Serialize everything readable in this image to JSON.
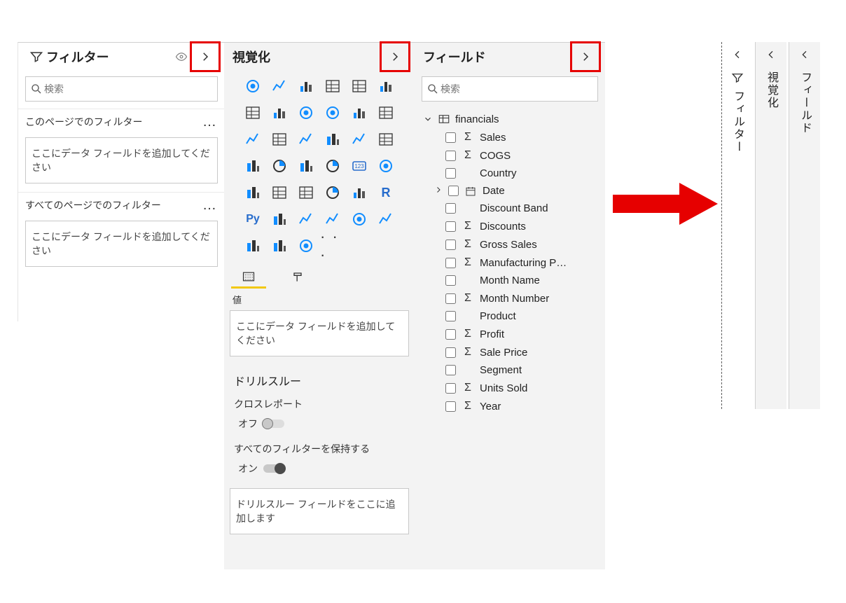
{
  "filters": {
    "title": "フィルター",
    "search_placeholder": "検索",
    "section_page": "このページでのフィルター",
    "section_all": "すべてのページでのフィルター",
    "dropzone_text": "ここにデータ フィールドを追加してください"
  },
  "viz": {
    "title": "視覚化",
    "values_label": "値",
    "values_drop": "ここにデータ フィールドを追加してください",
    "drill_heading": "ドリルスルー",
    "cross_report": "クロスレポート",
    "cross_report_state": "オフ",
    "keep_all": "すべてのフィルターを保持する",
    "keep_all_state": "オン",
    "drill_drop": "ドリルスルー フィールドをここに追加します"
  },
  "fields": {
    "title": "フィールド",
    "search_placeholder": "検索",
    "table": {
      "name": "financials",
      "columns": [
        {
          "name": "Sales",
          "sigma": true
        },
        {
          "name": "COGS",
          "sigma": true
        },
        {
          "name": "Country",
          "sigma": false
        },
        {
          "name": "Date",
          "sigma": false,
          "date": true,
          "expandable": true
        },
        {
          "name": "Discount Band",
          "sigma": false
        },
        {
          "name": "Discounts",
          "sigma": true
        },
        {
          "name": "Gross Sales",
          "sigma": true
        },
        {
          "name": "Manufacturing P…",
          "sigma": true
        },
        {
          "name": "Month Name",
          "sigma": false
        },
        {
          "name": "Month Number",
          "sigma": true
        },
        {
          "name": "Product",
          "sigma": false
        },
        {
          "name": "Profit",
          "sigma": true
        },
        {
          "name": "Sale Price",
          "sigma": true
        },
        {
          "name": "Segment",
          "sigma": false
        },
        {
          "name": "Units Sold",
          "sigma": true
        },
        {
          "name": "Year",
          "sigma": true
        }
      ]
    }
  },
  "collapsed": {
    "filters": "フィルター",
    "viz": "視覚化",
    "fields": "フィールド"
  },
  "icons": {
    "filter": "filter-icon",
    "eye": "eye-icon",
    "chevron_right": "chevron-right-icon",
    "chevron_left": "chevron-left-icon",
    "chevron_down": "chevron-down-icon",
    "search": "search-icon",
    "table": "table-icon",
    "date": "date-icon"
  },
  "viz_icons": [
    "stacked-bar",
    "stacked-column",
    "clustered-bar",
    "clustered-column",
    "hundred-bar",
    "hundred-column",
    "line",
    "area",
    "stacked-area",
    "line-stacked-column",
    "line-clustered-column",
    "ribbon",
    "waterfall",
    "funnel",
    "scatter",
    "pie",
    "donut",
    "treemap",
    "map",
    "filled-map",
    "shape-map",
    "gauge-arcgis",
    "card",
    "multi-row-card",
    "kpi",
    "slicer",
    "table",
    "matrix",
    "r-visual",
    "r-script",
    "python",
    "key-influencers",
    "decomposition-tree",
    "qna",
    "paginated",
    "narrative",
    "power-apps",
    "power-automate",
    "paginated-report-visual",
    "more-visuals"
  ]
}
